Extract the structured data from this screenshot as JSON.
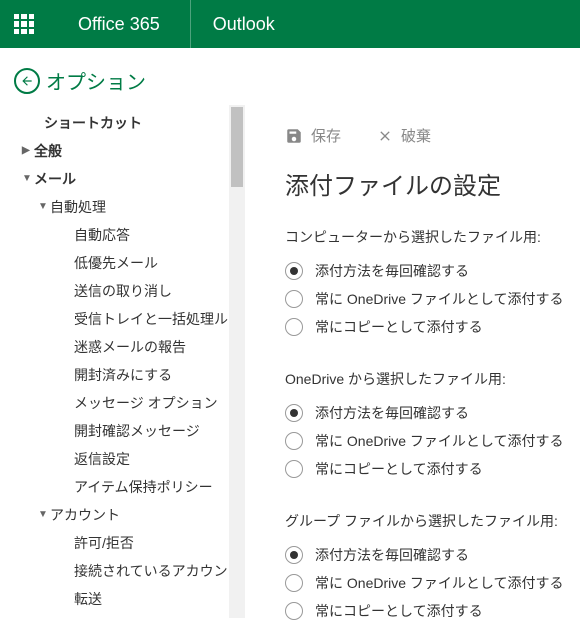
{
  "header": {
    "brand": "Office 365",
    "app": "Outlook"
  },
  "options": {
    "title": "オプション"
  },
  "sidebar": {
    "shortcut": "ショートカット",
    "general": "全般",
    "mail": "メール",
    "auto": "自動処理",
    "auto_items": [
      "自動応答",
      "低優先メール",
      "送信の取り消し",
      "受信トレイと一括処理ルール",
      "迷惑メールの報告",
      "開封済みにする",
      "メッセージ オプション",
      "開封確認メッセージ",
      "返信設定",
      "アイテム保持ポリシー"
    ],
    "account": "アカウント",
    "account_items": [
      "許可/拒否",
      "接続されているアカウント",
      "転送"
    ]
  },
  "toolbar": {
    "save": "保存",
    "discard": "破棄"
  },
  "page": {
    "title": "添付ファイルの設定"
  },
  "radio_labels": {
    "ask": "添付方法を毎回確認する",
    "onedrive": "常に OneDrive ファイルとして添付する",
    "copy": "常にコピーとして添付する"
  },
  "groups": [
    {
      "label": "コンピューターから選択したファイル用:",
      "selected": 0
    },
    {
      "label": "OneDrive から選択したファイル用:",
      "selected": 0
    },
    {
      "label": "グループ ファイルから選択したファイル用:",
      "selected": 0
    }
  ]
}
